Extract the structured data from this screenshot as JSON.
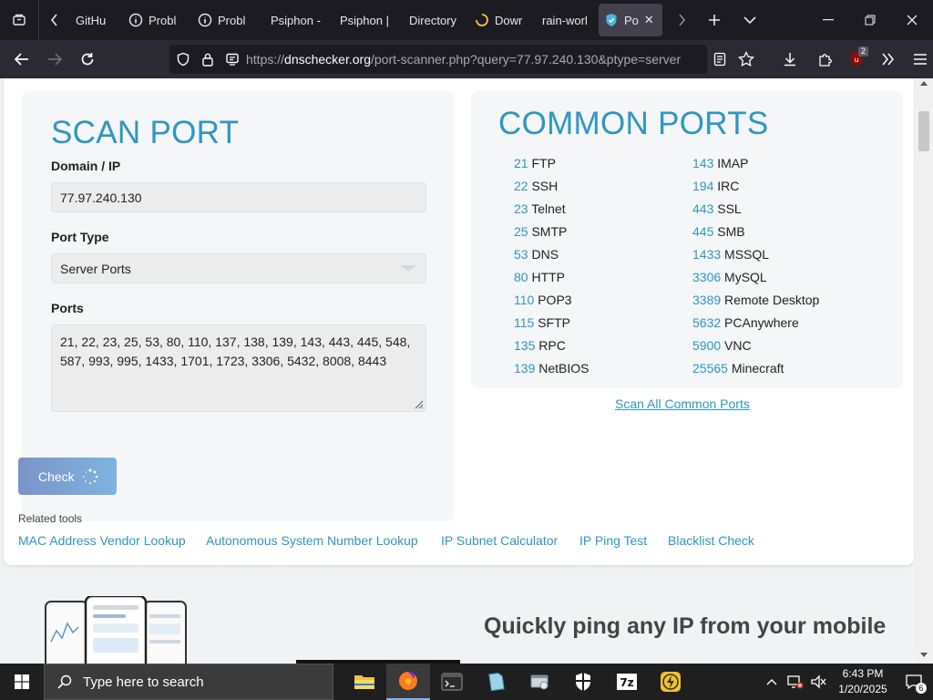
{
  "browser": {
    "tabs": [
      {
        "label": "GitHu",
        "icon": "github-icon"
      },
      {
        "label": "Probl",
        "icon": "info-icon"
      },
      {
        "label": "Probl",
        "icon": "info-icon"
      },
      {
        "label": "Psiphon -",
        "icon": "none"
      },
      {
        "label": "Psiphon |",
        "icon": "none"
      },
      {
        "label": "Directory",
        "icon": "none"
      },
      {
        "label": "Dowr",
        "icon": "loading-icon"
      },
      {
        "label": "rain-worl",
        "icon": "none"
      },
      {
        "label": "Po",
        "icon": "dnschecker-icon",
        "active": true
      }
    ],
    "url_prefix": "https://",
    "url_host": "dnschecker.org",
    "url_path": "/port-scanner.php?query=77.97.240.130&ptype=server",
    "extension_badge": "2"
  },
  "scan": {
    "heading": "SCAN PORT",
    "domain_label": "Domain / IP",
    "domain_value": "77.97.240.130",
    "port_type_label": "Port Type",
    "port_type_value": "Server Ports",
    "ports_label": "Ports",
    "ports_line1": "21, 22, 23, 25, 53, 80, 110, 137, 138, 139, 143, 443, 445, 548,",
    "ports_line2": "587, 993, 995, 1433, 1701, 1723, 3306, 5432, 8008, 8443",
    "check_label": "Check"
  },
  "common": {
    "heading": "COMMON PORTS",
    "left": [
      {
        "num": "21",
        "name": "FTP"
      },
      {
        "num": "22",
        "name": "SSH"
      },
      {
        "num": "23",
        "name": "Telnet"
      },
      {
        "num": "25",
        "name": "SMTP"
      },
      {
        "num": "53",
        "name": "DNS"
      },
      {
        "num": "80",
        "name": "HTTP"
      },
      {
        "num": "110",
        "name": "POP3"
      },
      {
        "num": "115",
        "name": "SFTP"
      },
      {
        "num": "135",
        "name": "RPC"
      },
      {
        "num": "139",
        "name": "NetBIOS"
      }
    ],
    "right": [
      {
        "num": "143",
        "name": "IMAP"
      },
      {
        "num": "194",
        "name": "IRC"
      },
      {
        "num": "443",
        "name": "SSL"
      },
      {
        "num": "445",
        "name": "SMB"
      },
      {
        "num": "1433",
        "name": "MSSQL"
      },
      {
        "num": "3306",
        "name": "MySQL"
      },
      {
        "num": "3389",
        "name": "Remote Desktop"
      },
      {
        "num": "5632",
        "name": "PCAnywhere"
      },
      {
        "num": "5900",
        "name": "VNC"
      },
      {
        "num": "25565",
        "name": "Minecraft"
      }
    ],
    "scan_all": "Scan All Common Ports"
  },
  "related": {
    "label": "Related tools",
    "links": [
      "MAC Address Vendor Lookup",
      "Autonomous System Number Lookup",
      "IP Subnet Calculator",
      "IP Ping Test",
      "Blacklist Check"
    ]
  },
  "promo": {
    "text": "Quickly ping any IP from your mobile"
  },
  "taskbar": {
    "search_placeholder": "Type here to search",
    "time": "6:43 PM",
    "date": "1/20/2025",
    "notification_count": "6"
  },
  "colors": {
    "accent": "#2f97c1",
    "chrome_dark": "#1c1b22",
    "taskbar": "#1f1f1f"
  }
}
